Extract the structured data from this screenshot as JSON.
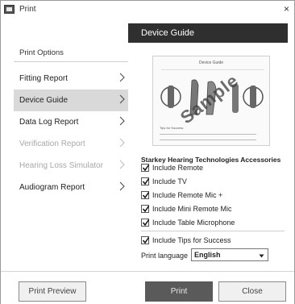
{
  "window": {
    "title": "Print",
    "close_glyph": "×"
  },
  "left": {
    "heading": "Print Options",
    "items": [
      {
        "label": "Fitting Report",
        "state": "normal"
      },
      {
        "label": "Device Guide",
        "state": "selected"
      },
      {
        "label": "Data Log Report",
        "state": "normal"
      },
      {
        "label": "Verification Report",
        "state": "disabled"
      },
      {
        "label": "Hearing Loss Simulator",
        "state": "disabled"
      },
      {
        "label": "Audiogram Report",
        "state": "normal"
      }
    ]
  },
  "right": {
    "header": "Device Guide",
    "preview": {
      "doc_title": "Device Guide",
      "doc_tips": "Tips for Success",
      "watermark": "Sample"
    },
    "accessories_title": "Starkey Hearing Technologies Accessories",
    "checkboxes": [
      {
        "label": "Include Remote",
        "checked": true
      },
      {
        "label": "Include TV",
        "checked": true
      },
      {
        "label": "Include Remote Mic +",
        "checked": true
      },
      {
        "label": "Include Mini Remote Mic",
        "checked": true
      },
      {
        "label": "Include Table Microphone",
        "checked": true
      }
    ],
    "tips_checkbox": {
      "label": "Include Tips for Success",
      "checked": true
    },
    "language": {
      "label": "Print language",
      "value": "English"
    }
  },
  "buttons": {
    "preview": "Print Preview",
    "print": "Print",
    "close": "Close"
  }
}
